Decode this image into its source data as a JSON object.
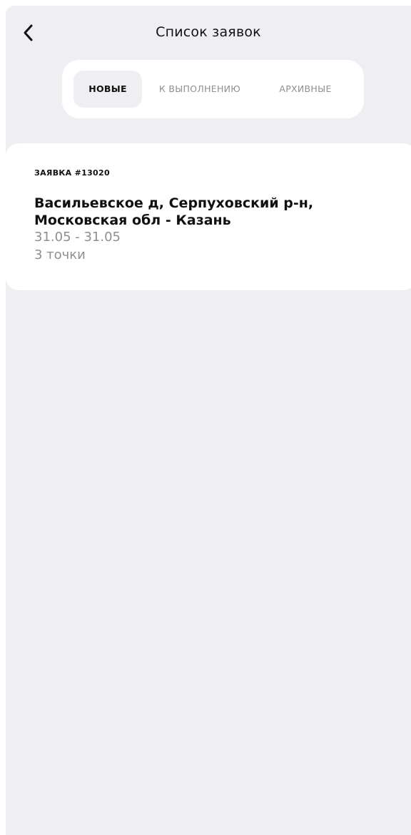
{
  "header": {
    "title": "Список заявок",
    "back_icon": "chevron-left-icon"
  },
  "tabs": [
    {
      "label": "НОВЫЕ",
      "active": true
    },
    {
      "label": "К ВЫПОЛНЕНИЮ",
      "active": false
    },
    {
      "label": "АРХИВНЫЕ",
      "active": false
    }
  ],
  "requests": [
    {
      "id_label": "ЗАЯВКА #13020",
      "route": "Васильевское д, Серпуховский р-н, Московская обл - Казань",
      "dates": "31.05 - 31.05",
      "points": "3 точки"
    }
  ],
  "colors": {
    "background": "#efeff3",
    "surface": "#ffffff",
    "text_primary": "#111111",
    "text_secondary": "#8e8e93"
  }
}
